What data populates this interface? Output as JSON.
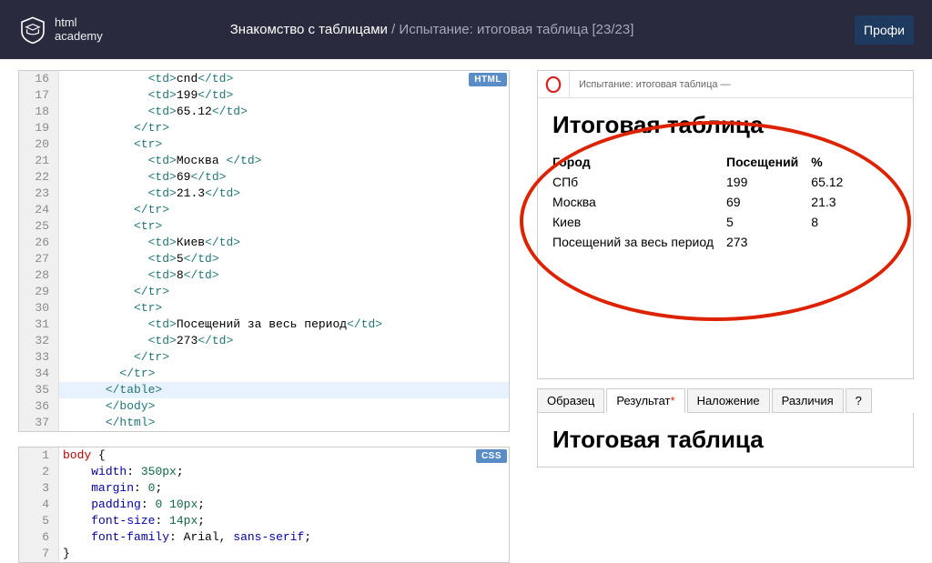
{
  "header": {
    "logo_line1": "html",
    "logo_line2": "academy",
    "crumb_main": "Знакомство с таблицами",
    "crumb_sep": " / ",
    "crumb_sub": "Испытание: итоговая таблица  [23/23]",
    "profile_btn": "Профи"
  },
  "html_editor": {
    "badge": "HTML",
    "lines": [
      {
        "n": 16,
        "ind": 12,
        "tokens": [
          [
            "tag",
            "<td>"
          ],
          [
            "",
            "cnd"
          ],
          [
            "tag",
            "</td>"
          ]
        ]
      },
      {
        "n": 17,
        "ind": 12,
        "tokens": [
          [
            "tag",
            "<td>"
          ],
          [
            "",
            "199"
          ],
          [
            "tag",
            "</td>"
          ]
        ]
      },
      {
        "n": 18,
        "ind": 12,
        "tokens": [
          [
            "tag",
            "<td>"
          ],
          [
            "",
            "65.12"
          ],
          [
            "tag",
            "</td>"
          ]
        ]
      },
      {
        "n": 19,
        "ind": 10,
        "tokens": [
          [
            "tag",
            "</tr>"
          ]
        ]
      },
      {
        "n": 20,
        "ind": 10,
        "tokens": [
          [
            "tag",
            "<tr>"
          ]
        ]
      },
      {
        "n": 21,
        "ind": 12,
        "tokens": [
          [
            "tag",
            "<td>"
          ],
          [
            "",
            "Москва "
          ],
          [
            "tag",
            "</td>"
          ]
        ]
      },
      {
        "n": 22,
        "ind": 12,
        "tokens": [
          [
            "tag",
            "<td>"
          ],
          [
            "",
            "69"
          ],
          [
            "tag",
            "</td>"
          ]
        ]
      },
      {
        "n": 23,
        "ind": 12,
        "tokens": [
          [
            "tag",
            "<td>"
          ],
          [
            "",
            "21.3"
          ],
          [
            "tag",
            "</td>"
          ]
        ]
      },
      {
        "n": 24,
        "ind": 10,
        "tokens": [
          [
            "tag",
            "</tr>"
          ]
        ]
      },
      {
        "n": 25,
        "ind": 10,
        "tokens": [
          [
            "tag",
            "<tr>"
          ]
        ]
      },
      {
        "n": 26,
        "ind": 12,
        "tokens": [
          [
            "tag",
            "<td>"
          ],
          [
            "",
            "Киев"
          ],
          [
            "tag",
            "</td>"
          ]
        ]
      },
      {
        "n": 27,
        "ind": 12,
        "tokens": [
          [
            "tag",
            "<td>"
          ],
          [
            "",
            "5"
          ],
          [
            "tag",
            "</td>"
          ]
        ]
      },
      {
        "n": 28,
        "ind": 12,
        "tokens": [
          [
            "tag",
            "<td>"
          ],
          [
            "",
            "8"
          ],
          [
            "tag",
            "</td>"
          ]
        ]
      },
      {
        "n": 29,
        "ind": 10,
        "tokens": [
          [
            "tag",
            "</tr>"
          ]
        ]
      },
      {
        "n": 30,
        "ind": 10,
        "tokens": [
          [
            "tag",
            "<tr>"
          ]
        ]
      },
      {
        "n": 31,
        "ind": 12,
        "tokens": [
          [
            "tag",
            "<td>"
          ],
          [
            "",
            "Посещений за весь период"
          ],
          [
            "tag",
            "</td>"
          ]
        ]
      },
      {
        "n": 32,
        "ind": 12,
        "tokens": [
          [
            "tag",
            "<td>"
          ],
          [
            "",
            "273"
          ],
          [
            "tag",
            "</td>"
          ]
        ]
      },
      {
        "n": 33,
        "ind": 10,
        "tokens": [
          [
            "tag",
            "</tr>"
          ]
        ]
      },
      {
        "n": 34,
        "ind": 8,
        "tokens": [
          [
            "tag",
            "</tr>"
          ]
        ]
      },
      {
        "n": 35,
        "ind": 6,
        "tokens": [
          [
            "tag",
            "</table>"
          ]
        ],
        "hl": true
      },
      {
        "n": 36,
        "ind": 6,
        "tokens": [
          [
            "tag",
            "</body>"
          ]
        ]
      },
      {
        "n": 37,
        "ind": 6,
        "tokens": [
          [
            "tag",
            "</html>"
          ]
        ]
      }
    ]
  },
  "css_editor": {
    "badge": "CSS",
    "lines": [
      {
        "n": 1,
        "ind": 0,
        "tokens": [
          [
            "sel",
            "body"
          ],
          [
            "",
            " {"
          ]
        ]
      },
      {
        "n": 2,
        "ind": 4,
        "tokens": [
          [
            "prop",
            "width"
          ],
          [
            "",
            ": "
          ],
          [
            "num",
            "350px"
          ],
          [
            "",
            ";"
          ]
        ]
      },
      {
        "n": 3,
        "ind": 4,
        "tokens": [
          [
            "prop",
            "margin"
          ],
          [
            "",
            ": "
          ],
          [
            "num",
            "0"
          ],
          [
            "",
            ";"
          ]
        ]
      },
      {
        "n": 4,
        "ind": 4,
        "tokens": [
          [
            "prop",
            "padding"
          ],
          [
            "",
            ": "
          ],
          [
            "num",
            "0"
          ],
          [
            "",
            " "
          ],
          [
            "num",
            "10px"
          ],
          [
            "",
            ";"
          ]
        ]
      },
      {
        "n": 5,
        "ind": 4,
        "tokens": [
          [
            "prop",
            "font-size"
          ],
          [
            "",
            ": "
          ],
          [
            "num",
            "14px"
          ],
          [
            "",
            ";"
          ]
        ]
      },
      {
        "n": 6,
        "ind": 4,
        "tokens": [
          [
            "prop",
            "font-family"
          ],
          [
            "",
            ": "
          ],
          [
            "",
            "Arial"
          ],
          [
            "",
            ", "
          ],
          [
            "kw",
            "sans-serif"
          ],
          [
            "",
            ";"
          ]
        ]
      },
      {
        "n": 7,
        "ind": 0,
        "tokens": [
          [
            "",
            "}"
          ]
        ]
      }
    ]
  },
  "preview": {
    "url": "Испытание: итоговая таблица —",
    "title": "Итоговая таблица",
    "headers": [
      "Город",
      "Посещений",
      "%"
    ],
    "rows": [
      [
        "СПб",
        "199",
        "65.12"
      ],
      [
        "Москва",
        "69",
        "21.3"
      ],
      [
        "Киев",
        "5",
        "8"
      ],
      [
        "Посещений за весь период",
        "273",
        ""
      ]
    ]
  },
  "tabs": {
    "t1": "Образец",
    "t2": "Результат",
    "t3": "Наложение",
    "t4": "Различия",
    "t5": "?"
  },
  "lower_title": "Итоговая таблица"
}
